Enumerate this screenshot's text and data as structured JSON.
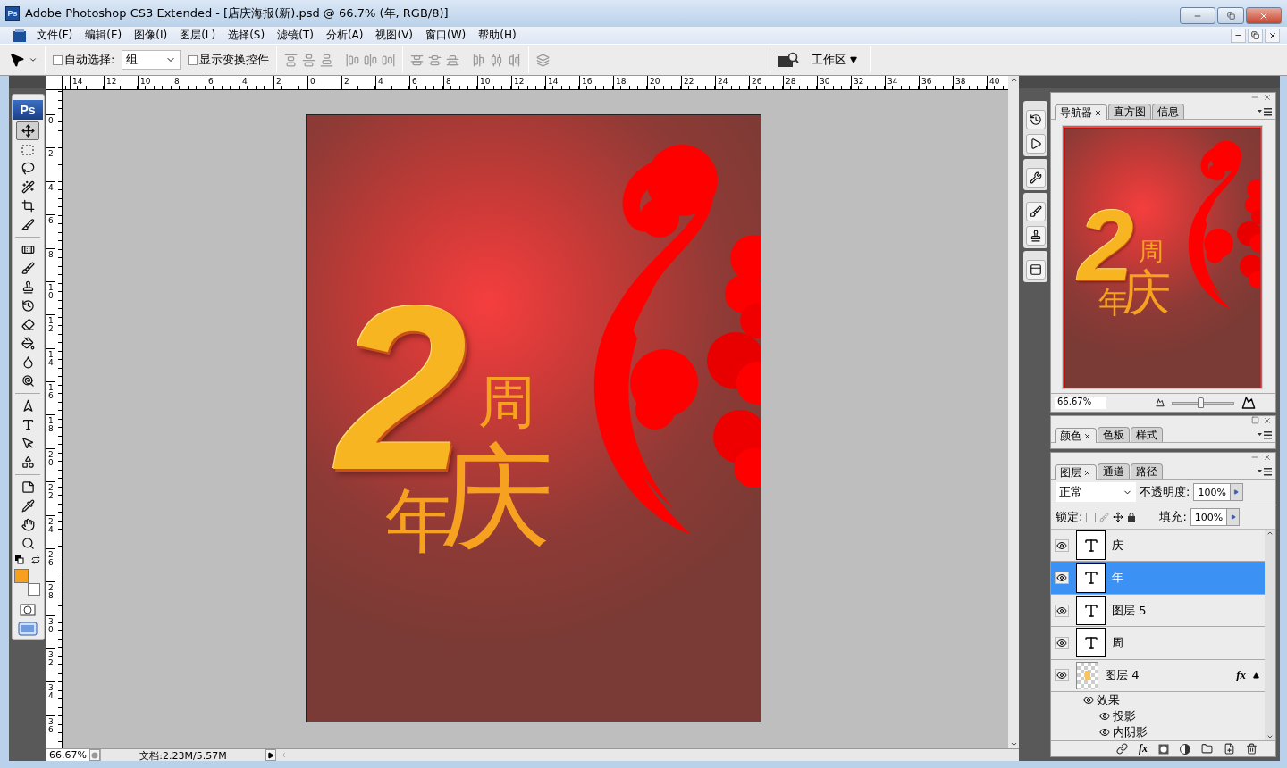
{
  "window": {
    "app_icon": "Ps",
    "title": "Adobe Photoshop CS3 Extended - [店庆海报(新).psd @ 66.7% (年, RGB/8)]"
  },
  "menu": [
    "文件(F)",
    "编辑(E)",
    "图像(I)",
    "图层(L)",
    "选择(S)",
    "滤镜(T)",
    "分析(A)",
    "视图(V)",
    "窗口(W)",
    "帮助(H)"
  ],
  "options_bar": {
    "auto_select": {
      "label": "自动选择:",
      "checked": false
    },
    "auto_select_target": "组",
    "transform_controls": {
      "label": "显示变换控件",
      "checked": false
    },
    "workspace": "工作区"
  },
  "toolbox": {
    "logo": "Ps",
    "tools": [
      {
        "selected": true
      },
      {
        "selected": false
      },
      {
        "selected": false
      },
      {
        "selected": false
      },
      {
        "selected": false
      },
      {
        "selected": false
      },
      {
        "selected": false
      },
      {
        "selected": false
      },
      {
        "selected": false
      },
      {
        "selected": false
      },
      {
        "selected": false
      },
      {
        "selected": false
      },
      {
        "selected": false
      },
      {
        "selected": false
      },
      {
        "selected": false
      },
      {
        "selected": false
      },
      {
        "selected": false
      },
      {
        "selected": false
      },
      {
        "selected": false
      },
      {
        "selected": false
      },
      {
        "selected": false
      },
      {
        "selected": false
      }
    ],
    "colors": [
      {
        "color": "#f7a01d"
      },
      {
        "color": "#ffffff"
      }
    ]
  },
  "rulers": {
    "horizontal": [
      "14",
      "12",
      "10",
      "8",
      "6",
      "4",
      "2",
      "0",
      "2",
      "4",
      "6",
      "8",
      "10",
      "12",
      "14",
      "16",
      "18",
      "20",
      "22",
      "24",
      "26",
      "28",
      "30",
      "32",
      "34",
      "36",
      "38",
      "40"
    ],
    "vertical": [
      "0",
      "2",
      "4",
      "6",
      "8",
      "10",
      "12",
      "14",
      "16",
      "18",
      "20",
      "22",
      "24",
      "26",
      "28",
      "30",
      "32",
      "34",
      "36"
    ]
  },
  "document": {
    "numeral": "2",
    "chars": [
      "周",
      "年",
      "庆"
    ]
  },
  "navigator": {
    "tabs": [
      {
        "label": "导航器",
        "selected": true
      },
      {
        "label": "直方图",
        "selected": false
      },
      {
        "label": "信息",
        "selected": false
      }
    ],
    "preview": {
      "numeral": "2",
      "chars": [
        "周",
        "年",
        "庆"
      ]
    },
    "zoom": "66.67%",
    "level": 0.45
  },
  "color_panel": {
    "tabs": [
      {
        "label": "颜色",
        "selected": true
      },
      {
        "label": "色板",
        "selected": false
      },
      {
        "label": "样式",
        "selected": false
      }
    ]
  },
  "layers_panel": {
    "tabs": [
      {
        "label": "图层",
        "selected": true
      },
      {
        "label": "通道",
        "selected": false
      },
      {
        "label": "路径",
        "selected": false
      }
    ],
    "blend_mode": "正常",
    "opacity_label": "不透明度:",
    "opacity": "100%",
    "lock_label": "锁定:",
    "fill_label": "填充:",
    "fill": "100%",
    "layers": [
      {
        "name": "庆",
        "kind": "text",
        "visible": true,
        "selected": false
      },
      {
        "name": "年",
        "kind": "text",
        "visible": true,
        "selected": true
      },
      {
        "name": "图层 5",
        "kind": "text",
        "visible": true,
        "selected": false
      },
      {
        "name": "周",
        "kind": "text",
        "visible": true,
        "selected": false
      },
      {
        "name": "图层 4",
        "kind": "pixel",
        "visible": true,
        "selected": false,
        "fx": "fx",
        "expanded": true,
        "children": [
          {
            "name": "效果",
            "visible": true,
            "children": [
              {
                "name": "投影",
                "visible": true
              },
              {
                "name": "内阴影",
                "visible": true
              }
            ]
          }
        ]
      }
    ],
    "footer_fx": "fx"
  },
  "status_bar": {
    "zoom": "66.67%",
    "info": "文档:2.23M/5.57M"
  }
}
